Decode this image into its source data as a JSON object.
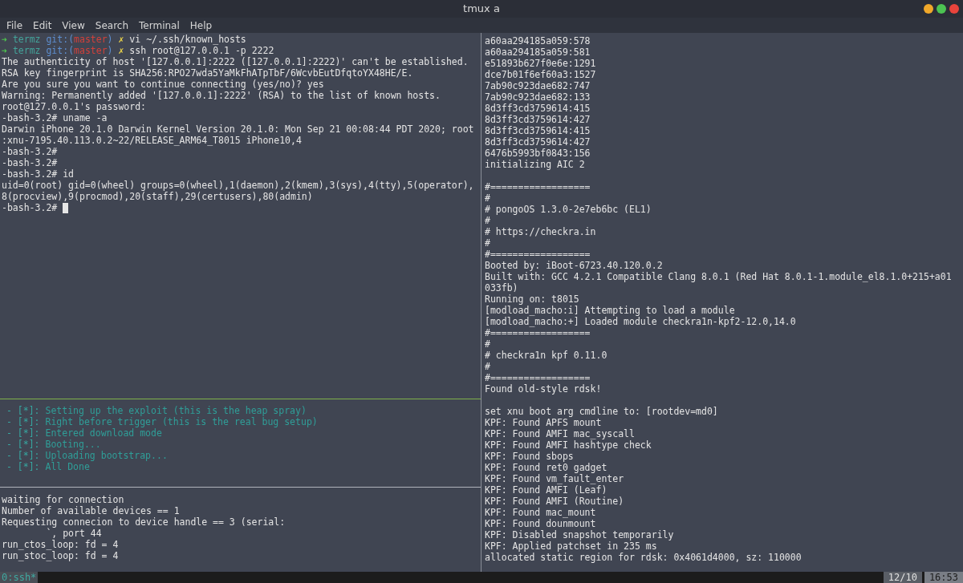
{
  "window": {
    "title": "tmux a"
  },
  "menu": [
    "File",
    "Edit",
    "View",
    "Search",
    "Terminal",
    "Help"
  ],
  "panes": {
    "shell": [
      {
        "kind": "prompt",
        "arrow": "➜",
        "dir": "termz",
        "git_open": "git:(",
        "branch": "master",
        "git_close": ")",
        "dirty": "✗",
        "command": "vi ~/.ssh/known_hosts"
      },
      {
        "kind": "prompt",
        "arrow": "➜",
        "dir": "termz",
        "git_open": "git:(",
        "branch": "master",
        "git_close": ")",
        "dirty": "✗",
        "command": "ssh root@127.0.0.1 -p 2222"
      },
      {
        "kind": "text",
        "text": "The authenticity of host '[127.0.0.1]:2222 ([127.0.0.1]:2222)' can't be established."
      },
      {
        "kind": "text",
        "text": "RSA key fingerprint is SHA256:RPO27wda5YaMkFhATpTbF/6WcvbEutDfqtoYX48HE/E."
      },
      {
        "kind": "text",
        "text": "Are you sure you want to continue connecting (yes/no)? yes"
      },
      {
        "kind": "text",
        "text": "Warning: Permanently added '[127.0.0.1]:2222' (RSA) to the list of known hosts."
      },
      {
        "kind": "text",
        "text": "root@127.0.0.1's password:"
      },
      {
        "kind": "text",
        "text": "-bash-3.2# uname -a"
      },
      {
        "kind": "text",
        "text": "Darwin iPhone 20.1.0 Darwin Kernel Version 20.1.0: Mon Sep 21 00:08:44 PDT 2020; root"
      },
      {
        "kind": "text",
        "text": ":xnu-7195.40.113.0.2~22/RELEASE_ARM64_T8015 iPhone10,4"
      },
      {
        "kind": "text",
        "text": "-bash-3.2#"
      },
      {
        "kind": "text",
        "text": "-bash-3.2#"
      },
      {
        "kind": "text",
        "text": "-bash-3.2# id"
      },
      {
        "kind": "text",
        "text": "uid=0(root) gid=0(wheel) groups=0(wheel),1(daemon),2(kmem),3(sys),4(tty),5(operator),"
      },
      {
        "kind": "text",
        "text": "8(procview),9(procmod),20(staff),29(certusers),80(admin)"
      },
      {
        "kind": "cursor",
        "text": "-bash-3.2# "
      }
    ],
    "steps": [
      {
        "bullet": "- [*]:",
        "message": "Setting up the exploit (this is the heap spray)"
      },
      {
        "bullet": "- [*]:",
        "message": "Right before trigger (this is the real bug setup)"
      },
      {
        "bullet": "- [*]:",
        "message": "Entered download mode"
      },
      {
        "bullet": "- [*]:",
        "message": "Booting..."
      },
      {
        "bullet": "- [*]:",
        "message": "Uploading bootstrap..."
      },
      {
        "bullet": "- [*]:",
        "message": "All Done"
      }
    ],
    "proxy": [
      "waiting for connection",
      "Number of available devices == 1",
      "Requesting connecion to device handle == 3 (serial:",
      "        `, port 44",
      "run_ctos_loop: fd = 4",
      "run_stoc_loop: fd = 4"
    ],
    "boot_log": [
      [
        "a60aa294185a059:578",
        "a60aa294185a059:581",
        "e51893b627f0e6e:1291",
        "dce7b01f6ef60a3:1527",
        "7ab90c923dae682:747",
        "7ab90c923dae682:133",
        "8d3ff3cd3759614:415",
        "8d3ff3cd3759614:427",
        "8d3ff3cd3759614:415",
        "8d3ff3cd3759614:427",
        "6476b5993bf0843:156",
        "initializing AIC 2"
      ],
      [
        "#==================",
        "#",
        "# pongoOS 1.3.0-2e7eb6bc (EL1)",
        "#",
        "# https://checkra.in",
        "#",
        "#==================",
        "Booted by: iBoot-6723.40.120.0.2",
        "Built with: GCC 4.2.1 Compatible Clang 8.0.1 (Red Hat 8.0.1-1.module_el8.1.0+215+a01",
        "033fb)",
        "Running on: t8015",
        "[modload_macho:i] Attempting to load a module",
        "[modload_macho:+] Loaded module checkra1n-kpf2-12.0,14.0",
        "#==================",
        "#",
        "# checkra1n kpf 0.11.0",
        "#",
        "#==================",
        "Found old-style rdsk!"
      ],
      [
        "set xnu boot arg cmdline to: [rootdev=md0]",
        "KPF: Found APFS mount",
        "KPF: Found AMFI mac_syscall",
        "KPF: Found AMFI hashtype check",
        "KPF: Found sbops",
        "KPF: Found ret0 gadget",
        "KPF: Found vm_fault_enter",
        "KPF: Found AMFI (Leaf)",
        "KPF: Found AMFI (Routine)",
        "KPF: Found mac_mount",
        "KPF: Found dounmount",
        "KPF: Disabled snapshot temporarily",
        "KPF: Applied patchset in 235 ms",
        "allocated static region for rdsk: 0x4061d4000, sz: 110000"
      ]
    ]
  },
  "status_bar": {
    "window_tab": "0:ssh*",
    "date": "12/10",
    "time": "16:53"
  }
}
